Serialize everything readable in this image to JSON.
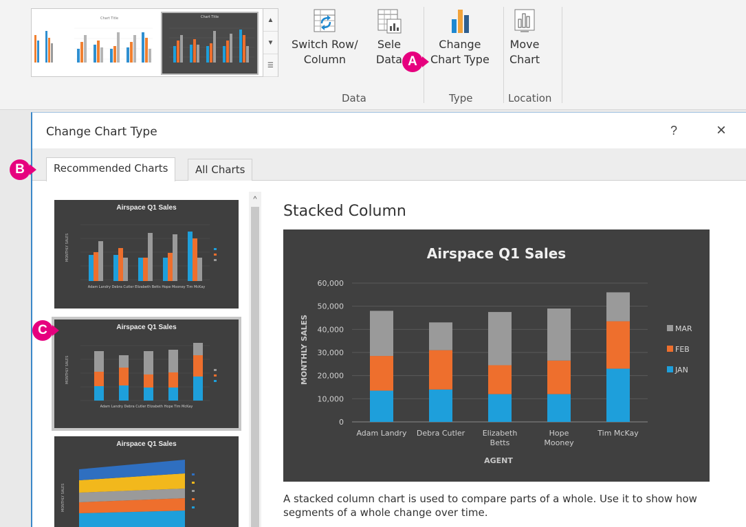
{
  "ribbon": {
    "gallery": {
      "thumb_title": "Chart Title",
      "selected_thumb_title": "Chart Title"
    },
    "groups": {
      "data": {
        "label": "Data",
        "switch_row_column": [
          "Switch Row/",
          "Column"
        ],
        "select_data": [
          "Sele",
          "Data"
        ]
      },
      "type": {
        "label": "Type",
        "change_chart_type": [
          "Change",
          "Chart Type"
        ]
      },
      "location": {
        "label": "Location",
        "move_chart": [
          "Move",
          "Chart"
        ]
      }
    }
  },
  "callouts": {
    "a": "A",
    "b": "B",
    "c": "C"
  },
  "dialog": {
    "title": "Change Chart Type",
    "help": "?",
    "close": "×",
    "tabs": {
      "recommended": "Recommended Charts",
      "all": "All Charts"
    },
    "list": {
      "scroll_up": "^",
      "cards": [
        {
          "title": "Airspace Q1 Sales",
          "type": "clustered-column"
        },
        {
          "title": "Airspace Q1 Sales",
          "type": "stacked-column"
        },
        {
          "title": "Airspace Q1 Sales",
          "type": "stacked-area"
        }
      ]
    },
    "preview_name": "Stacked Column",
    "description": "A stacked column chart is used to compare parts of a whole. Use it to show how segments of a whole change over time."
  },
  "chart_data": {
    "type": "bar",
    "stacked": true,
    "title": "Airspace Q1 Sales",
    "xlabel": "AGENT",
    "ylabel": "MONTHLY SALES",
    "ylim": [
      0,
      60000
    ],
    "yticks": [
      "0",
      "10,000",
      "20,000",
      "30,000",
      "40,000",
      "50,000",
      "60,000"
    ],
    "categories": [
      "Adam Landry",
      "Debra Cutler",
      "Elizabeth Betts",
      "Hope Mooney",
      "Tim McKay"
    ],
    "category_lines": [
      [
        "Adam Landry"
      ],
      [
        "Debra Cutler"
      ],
      [
        "Elizabeth",
        "Betts"
      ],
      [
        "Hope",
        "Mooney"
      ],
      [
        "Tim McKay"
      ]
    ],
    "series": [
      {
        "name": "JAN",
        "color": "#1e9fdb",
        "values": [
          13500,
          14000,
          12000,
          12000,
          23000
        ]
      },
      {
        "name": "FEB",
        "color": "#ee6f2d",
        "values": [
          15000,
          17000,
          12500,
          14500,
          20500
        ]
      },
      {
        "name": "MAR",
        "color": "#9a9a9a",
        "values": [
          19500,
          12000,
          23000,
          22500,
          12500
        ]
      }
    ],
    "legend": "right",
    "legend_order": [
      "MAR",
      "FEB",
      "JAN"
    ],
    "grid": true
  }
}
